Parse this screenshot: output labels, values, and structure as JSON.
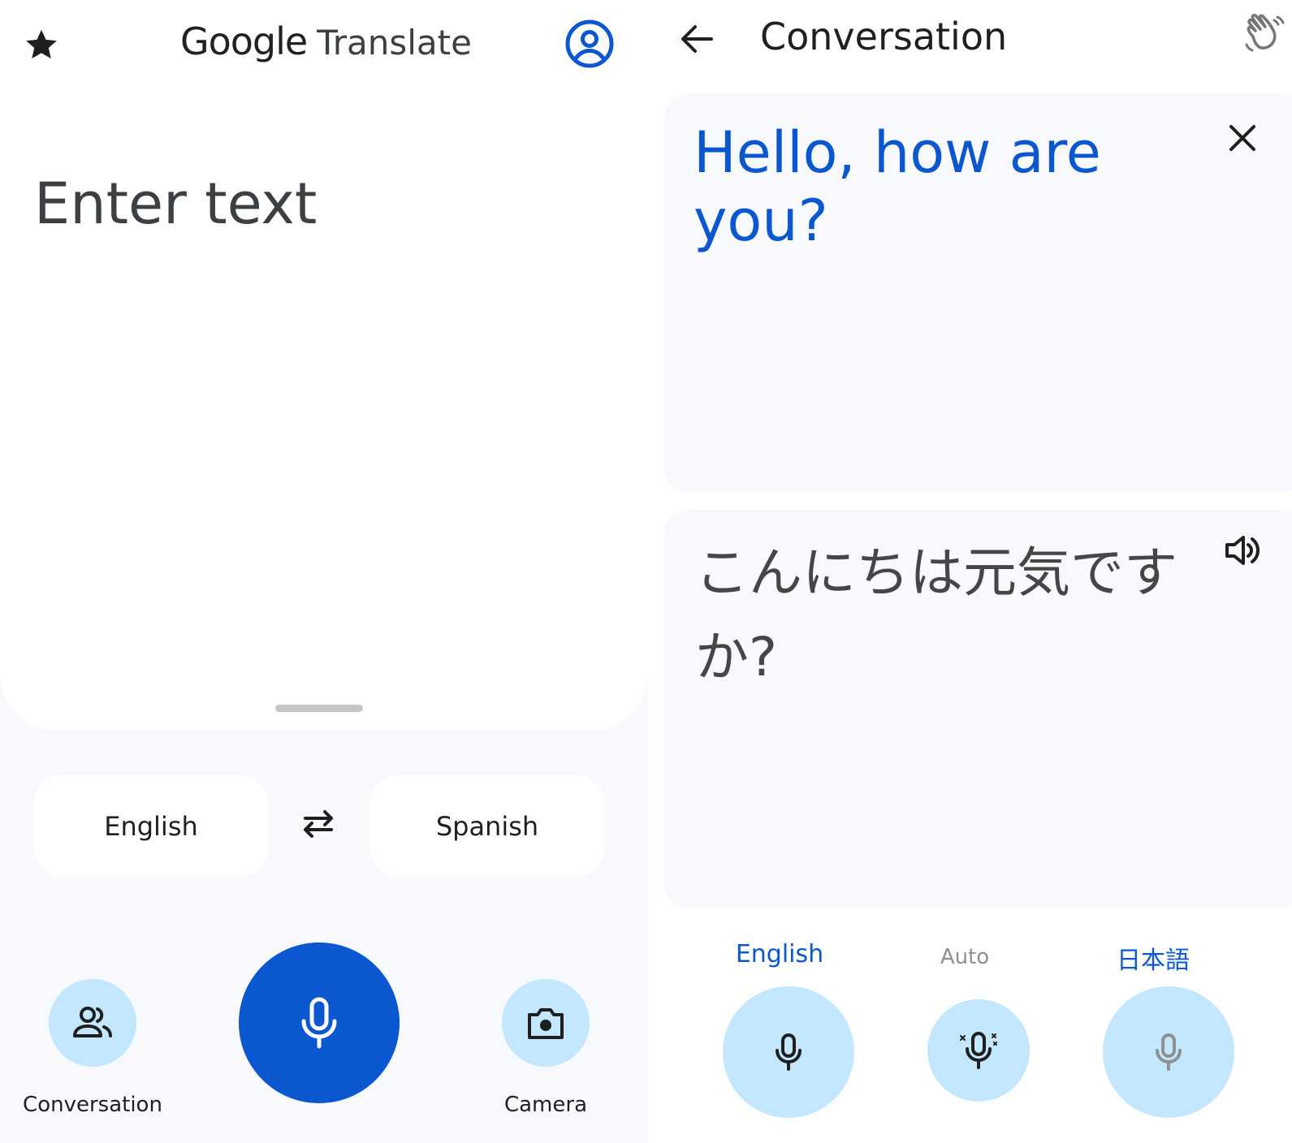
{
  "home": {
    "app_brand": {
      "google": "Google",
      "translate": "Translate"
    },
    "input_placeholder": "Enter text",
    "source_language": "English",
    "target_language": "Spanish",
    "conversation_label": "Conversation",
    "camera_label": "Camera",
    "icons": {
      "favorites": "star-icon",
      "account": "account-circle-icon",
      "swap": "swap-arrows-icon",
      "conversation": "people-icon",
      "microphone": "mic-icon",
      "camera": "camera-icon"
    }
  },
  "conversation": {
    "title": "Conversation",
    "source_text": "Hello, how are you?",
    "translated_text": "こんにちは元気ですか?",
    "languages": {
      "left": "English",
      "center": "Auto",
      "right": "日本語"
    },
    "icons": {
      "back": "arrow-back-icon",
      "wave": "waving-hand-icon",
      "close": "close-icon",
      "speaker": "speaker-icon",
      "mic_left": "mic-icon",
      "mic_auto": "auto-mic-icon",
      "mic_right": "mic-icon"
    }
  },
  "colors": {
    "accent": "#0b57d0",
    "light_accent": "#c2e7ff",
    "surface": "#f7f9fc",
    "text_primary": "#1f1f1f",
    "text_muted": "#8e918f"
  }
}
